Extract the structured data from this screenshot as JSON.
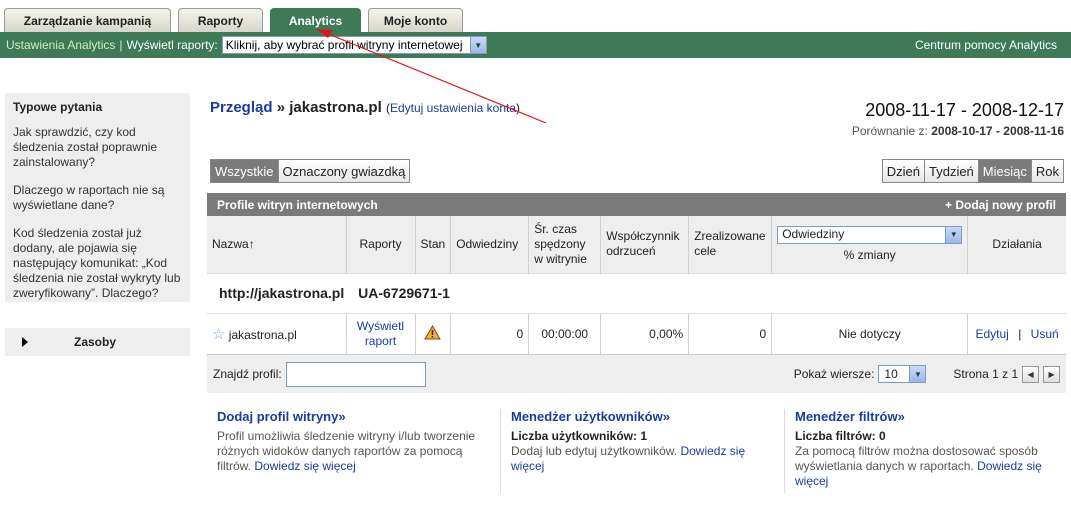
{
  "tabs": [
    {
      "label": "Zarządzanie kampanią",
      "active": false
    },
    {
      "label": "Raporty",
      "active": false
    },
    {
      "label": "Analytics",
      "active": true
    },
    {
      "label": "Moje konto",
      "active": false
    }
  ],
  "greenbar": {
    "settings": "Ustawienia Analytics",
    "separator": "|",
    "view_reports": "Wyświetl raporty:",
    "profile_select": "Kliknij, aby wybrać profil witryny internetowej",
    "help_center": "Centrum pomocy Analytics"
  },
  "sidebar": {
    "faq_title": "Typowe pytania",
    "questions": [
      "Jak sprawdzić, czy kod śledzenia został poprawnie zainstalowany?",
      "Dlaczego w raportach nie są wyświetlane dane?",
      "Kod śledzenia został już dodany, ale pojawia się następujący komunikat: „Kod śledzenia nie został wykryty lub zweryfikowany”. Dlaczego?"
    ],
    "resources": "Zasoby"
  },
  "header": {
    "overview": "Przegląd",
    "arrow": "»",
    "account": "jakastrona.pl",
    "edit_settings": "Edytuj ustawienia konta",
    "date_range": "2008-11-17 - 2008-12-17",
    "compare_label": "Porównanie z:",
    "compare_range": "2008-10-17 - 2008-11-16"
  },
  "filters": {
    "all": "Wszystkie",
    "starred": "Oznaczony gwiazdką"
  },
  "periods": [
    "Dzień",
    "Tydzień",
    "Miesiąc",
    "Rok"
  ],
  "active_period": "Miesiąc",
  "table": {
    "title": "Profile witryn internetowych",
    "add_profile": "+ Dodaj nowy profil",
    "columns": {
      "name": "Nazwa",
      "reports": "Raporty",
      "status": "Stan",
      "visits": "Odwiedziny",
      "avg_time": "Śr. czas spędzony w witrynie",
      "bounce": "Współczynnik odrzuceń",
      "goals": "Zrealizowane cele",
      "metric_select": "Odwiedziny",
      "pct_change": "% zmiany",
      "actions": "Działania"
    },
    "account_url": "http://jakastrona.pl",
    "account_id": "UA-6729671-1",
    "row": {
      "name": "jakastrona.pl",
      "view_report": "Wyświetl raport",
      "visits": "0",
      "avg_time": "00:00:00",
      "bounce": "0,00%",
      "goals": "0",
      "change": "Nie dotyczy",
      "edit": "Edytuj",
      "sep": "|",
      "delete": "Usuń"
    },
    "find_profile": "Znajdź profil:",
    "show_rows": "Pokaż wiersze:",
    "rows_value": "10",
    "page_info": "Strona 1 z 1"
  },
  "bottom": {
    "add_profile": {
      "title": "Dodaj profil witryny»",
      "text": "Profil umożliwia śledzenie witryny i/lub tworzenie różnych widoków danych raportów za pomocą filtrów.",
      "more": "Dowiedz się więcej"
    },
    "users": {
      "title": "Menedżer użytkowników»",
      "count": "Liczba użytkowników: 1",
      "text": "Dodaj lub edytuj użytkowników.",
      "more": "Dowiedz się więcej"
    },
    "filters": {
      "title": "Menedżer filtrów»",
      "count": "Liczba filtrów: 0",
      "text": "Za pomocą filtrów można dostosować sposób wyświetlania danych w raportach.",
      "more": "Dowiedz się więcej"
    }
  },
  "colors": {
    "brand_green": "#3e7a57",
    "link_blue": "#1a3d9c",
    "annotation_red": "#e0141e"
  }
}
